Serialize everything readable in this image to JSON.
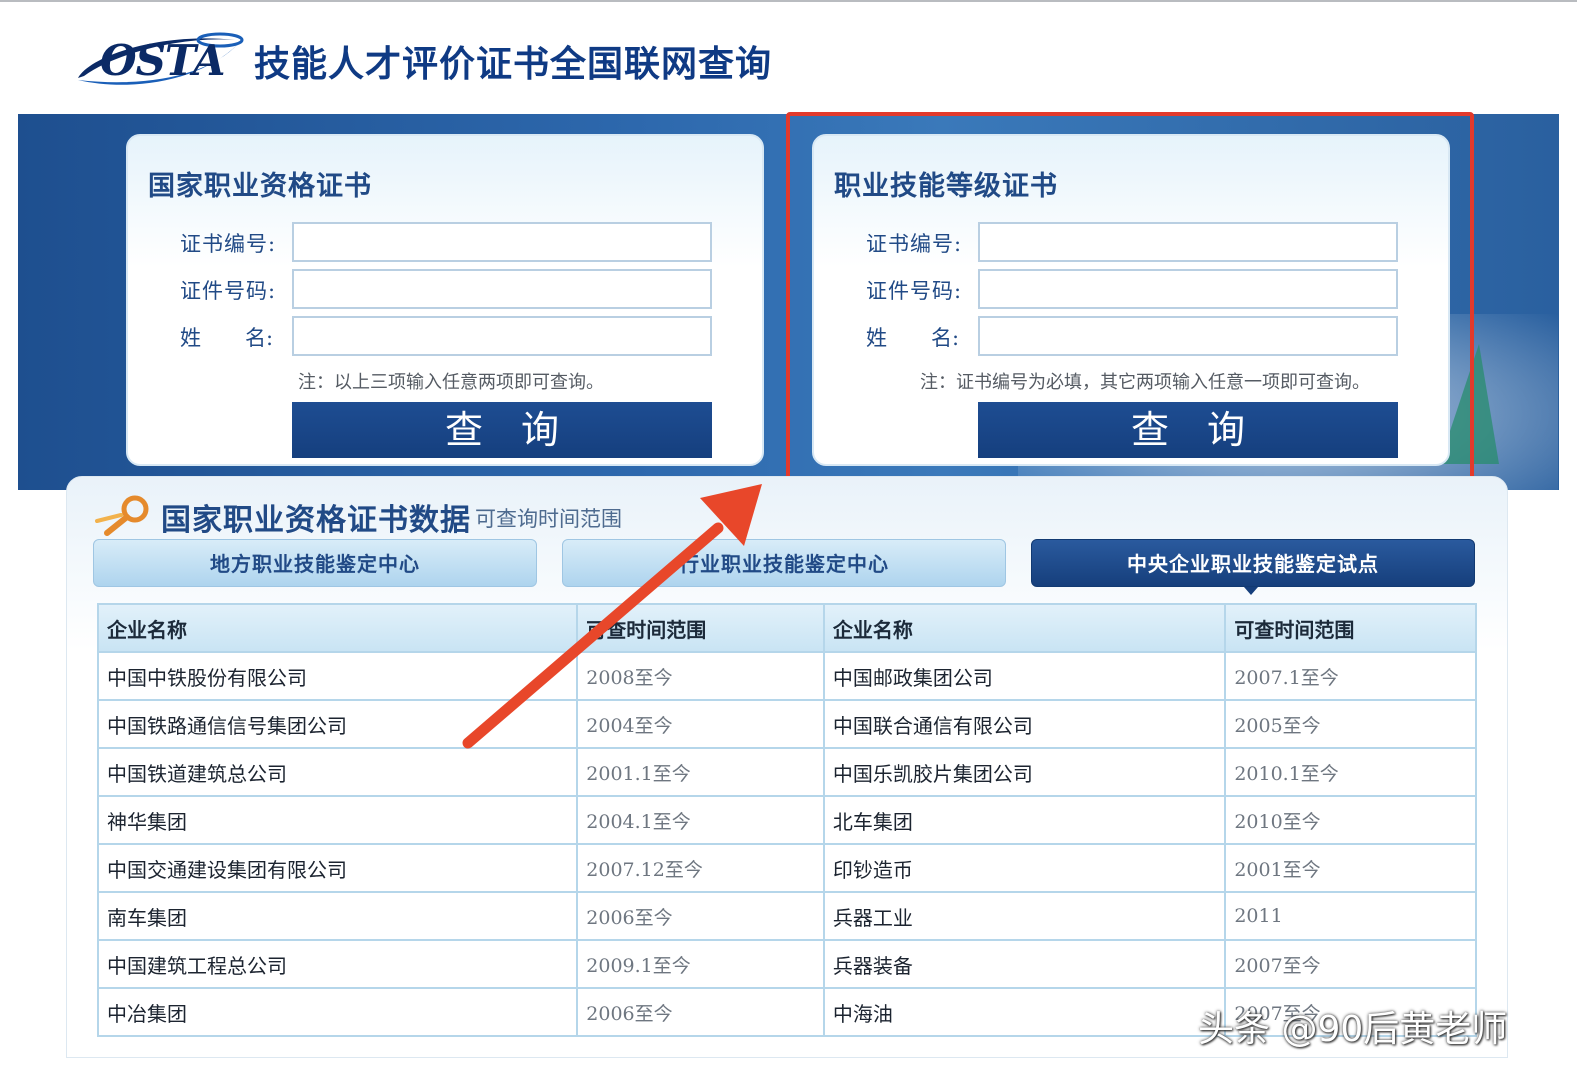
{
  "header": {
    "logo_text": "OSTA",
    "site_title": "技能人才评价证书全国联网查询"
  },
  "query_panels": [
    {
      "title": "国家职业资格证书",
      "fields": [
        {
          "label": "证书编号:",
          "value": ""
        },
        {
          "label": "证件号码:",
          "value": ""
        },
        {
          "label_a": "姓",
          "label_b": "名:",
          "value": ""
        }
      ],
      "note": "注：以上三项输入任意两项即可查询。",
      "button_a": "查",
      "button_b": "询"
    },
    {
      "title": "职业技能等级证书",
      "fields": [
        {
          "label": "证书编号:",
          "value": ""
        },
        {
          "label": "证件号码:",
          "value": ""
        },
        {
          "label_a": "姓",
          "label_b": "名:",
          "value": ""
        }
      ],
      "note": "注：证书编号为必填，其它两项输入任意一项即可查询。",
      "button_a": "查",
      "button_b": "询"
    }
  ],
  "data_section": {
    "title": "国家职业资格证书数据",
    "subtitle": "可查询时间范围",
    "tabs": [
      {
        "label": "地方职业技能鉴定中心",
        "active": false
      },
      {
        "label": "行业职业技能鉴定中心",
        "active": false
      },
      {
        "label": "中央企业职业技能鉴定试点",
        "active": true
      }
    ],
    "columns": [
      "企业名称",
      "可查时间范围",
      "企业名称",
      "可查时间范围"
    ],
    "rows": [
      [
        "中国中铁股份有限公司",
        "2008至今",
        "中国邮政集团公司",
        "2007.1至今"
      ],
      [
        "中国铁路通信信号集团公司",
        "2004至今",
        "中国联合通信有限公司",
        "2005至今"
      ],
      [
        "中国铁道建筑总公司",
        "2001.1至今",
        "中国乐凯胶片集团公司",
        "2010.1至今"
      ],
      [
        "神华集团",
        "2004.1至今",
        "北车集团",
        "2010至今"
      ],
      [
        "中国交通建设集团有限公司",
        "2007.12至今",
        "印钞造币",
        "2001至今"
      ],
      [
        "南车集团",
        "2006至今",
        "兵器工业",
        "2011"
      ],
      [
        "中国建筑工程总公司",
        "2009.1至今",
        "兵器装备",
        "2007至今"
      ],
      [
        "中冶集团",
        "2006至今",
        "中海油",
        "2007至今"
      ]
    ]
  },
  "overlay": {
    "highlight_color": "#e23a2c",
    "arrow_color": "#e8472a",
    "watermark": "头条 @90后黄老师"
  },
  "colors": {
    "brand_blue": "#214a86",
    "button_blue": "#153f7e",
    "band_blue": "#2d68ad"
  }
}
